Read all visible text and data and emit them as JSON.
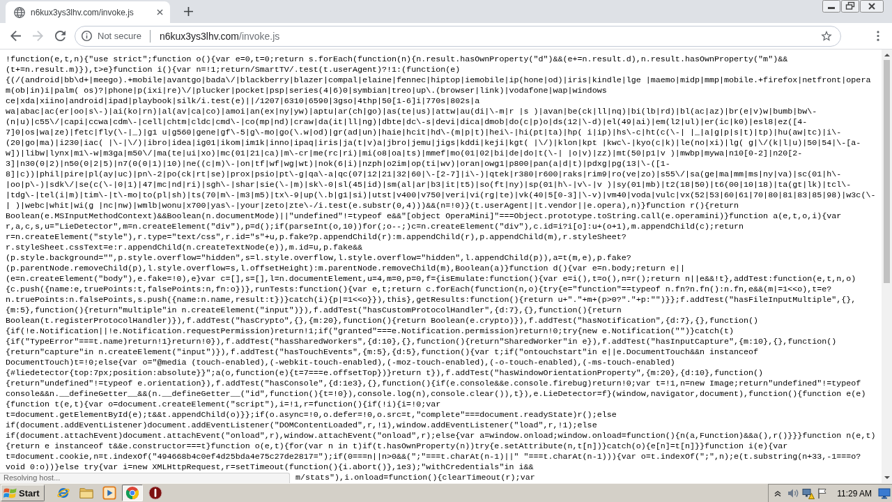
{
  "tabs": [
    {
      "title": "n6kux3ys3lhv.com/invoke.js",
      "selected": true
    }
  ],
  "toolbar": {
    "nav_buttons": [
      {
        "kind": "back",
        "disabled": false
      },
      {
        "kind": "forward",
        "disabled": true
      },
      {
        "kind": "reload",
        "disabled": false
      }
    ],
    "address": {
      "security_label": "Not secure",
      "host": "n6kux3ys3lhv.com",
      "path": "/invoke.js"
    }
  },
  "page": {
    "lines": [
      "!function(e,t,n){\"use strict\";function o(){var e=0,t=0;return s.forEach(function(n){n.result.hasOwnProperty(\"d\")&&(e+=n.result.d),n.result.hasOwnProperty(\"m\")&&",
      "(t+=n.result.m)}),t>e}function i(){var n=!1;return/SmartTV/.test(t.userAgent)?!1:(function(e)",
      "{(/(android|bb\\d+|meego).+mobile|avantgo|bada\\/|blackberry|blazer|compal|elaine|fennec|hiptop|iemobile|ip(hone|od)|iris|kindle|lge |maemo|midp|mmp|mobile.+firefox|netfront|opera",
      "m(ob|in)i|palm( os)?|phone|p(ixi|re)\\/|plucker|pocket|psp|series(4|6)0|symbian|treo|up\\.(browser|link)|vodafone|wap|windows",
      "ce|xda|xiino|android|ipad|playbook|silk/i.test(e)||/1207|6310|6590|3gso|4thp|50[1-6]i|770s|802s|a",
      "wa|abac|ac(er|oo|s\\-)|ai(ko|rn)|al(av|ca|co)|amoi|an(ex|ny|yw)|aptu|ar(ch|go)|as(te|us)|attw|au(di|\\-m|r |s )|avan|be(ck|ll|nq)|bi(lb|rd)|bl(ac|az)|br(e|v)w|bumb|bw\\-",
      "(n|u)|c55\\/|capi|ccwa|cdm\\-|cell|chtm|cldc|cmd\\-|co(mp|nd)|craw|da(it|ll|ng)|dbte|dc\\-s|devi|dica|dmob|do(c|p)o|ds(12|\\-d)|el(49|ai)|em(l2|ul)|er(ic|k0)|esl8|ez([4-",
      "7]0|os|wa|ze)|fetc|fly(\\-|_)|g1 u|g560|gene|gf\\-5|g\\-mo|go(\\.w|od)|gr(ad|un)|haie|hcit|hd\\-(m|p|t)|hei\\-|hi(pt|ta)|hp( i|ip)|hs\\-c|ht(c(\\-| |_|a|g|p|s|t)|tp)|hu(aw|tc)|i\\-",
      "(20|go|ma)|i230|iac( |\\-|\\/)|ibro|idea|ig01|ikom|im1k|inno|ipaq|iris|ja(t|v)a|jbro|jemu|jigs|kddi|keji|kgt( |\\/)|klon|kpt |kwc\\-|kyo(c|k)|le(no|xi)|lg( g|\\/(k|l|u)|50|54|\\-[a-",
      "w])|libw|lynx|m1\\-w|m3ga|m50\\/|ma(te|ui|xo)|mc(01|21|ca)|m\\-cr|me(rc|ri)|mi(o8|oa|ts)|mmef|mo(01|02|bi|de|do|t(\\-| |o|v)|zz)|mt(50|p1|v )|mwbp|mywa|n10[0-2]|n20[2-",
      "3]|n30(0|2)|n50(0|2|5)|n7(0(0|1)|10)|ne((c|m)\\-|on|tf|wf|wg|wt)|nok(6|i)|nzph|o2im|op(ti|wv)|oran|owg1|p800|pan(a|d|t)|pdxg|pg(13|\\-([1-",
      "8]|c))|phil|pire|pl(ay|uc)|pn\\-2|po(ck|rt|se)|prox|psio|pt\\-g|qa\\-a|qc(07|12|21|32|60|\\-[2-7]|i\\-)|qtek|r380|r600|raks|rim9|ro(ve|zo)|s55\\/|sa(ge|ma|mm|ms|ny|va)|sc(01|h\\-",
      "|oo|p\\-)|sdk\\/|se(c(\\-|0|1)|47|mc|nd|ri)|sgh\\-|shar|sie(\\-|m)|sk\\-0|sl(45|id)|sm(al|ar|b3|it|t5)|so(ft|ny)|sp(01|h\\-|v\\-|v )|sy(01|mb)|t2(18|50)|t6(00|10|18)|ta(gt|lk)|tcl\\-",
      "|tdg\\-|tel(i|m)|tim\\-|t\\-mo|to(pl|sh)|ts(70|m\\-|m3|m5)|tx\\-9|up(\\.b|g1|si)|utst|v400|v750|veri|vi(rg|te)|vk(40|5[0-3]|\\-v)|vm40|voda|vulc|vx(52|53|60|61|70|80|81|83|85|98)|w3c(\\-",
      "| )|webc|whit|wi(g |nc|nw)|wmlb|wonu|x700|yas\\-|your|zeto|zte\\-/i.test(e.substr(0,4)))&&(n=!0)}(t.userAgent||t.vendor||e.opera),n)}function r(){return",
      "Boolean(e.MSInputMethodContext)&&Boolean(n.documentMode)||\"undefined\"!=typeof e&&\"[object OperaMini]\"===Object.prototype.toString.call(e.operamini)}function a(e,t,o,i){var",
      "r,a,c,s,u=\"LieDetector\",m=n.createElement(\"div\"),p=d();if(parseInt(o,10))for(;o--;)c=n.createElement(\"div\"),c.id=i?i[o]:u+(o+1),m.appendChild(c);return",
      "r=n.createElement(\"style\"),r.type=\"text/css\",r.id=\"s\"+u,p.fake?p.appendChild(r):m.appendChild(r),p.appendChild(m),r.styleSheet?",
      "r.styleSheet.cssText=e:r.appendChild(n.createTextNode(e)),m.id=u,p.fake&&",
      "(p.style.background=\"\",p.style.overflow=\"hidden\",s=l.style.overflow,l.style.overflow=\"hidden\",l.appendChild(p)),a=t(m,e),p.fake?",
      "(p.parentNode.removeChild(p),l.style.overflow=s,l.offsetHeight):m.parentNode.removeChild(m),Boolean(a)}function d(){var e=n.body;return e||",
      "(e=n.createElement(\"body\"),e.fake=!0),e}var c=[],s=[],l=n.documentElement,u=4,m=0,p=0,f={isEmulate:function(){var e=i(),t=o(),n=r();return n||e&&!t},addTest:function(e,t,n,o)",
      "{c.push({name:e,truePoints:t,falsePoints:n,fn:o})},runTests:function(){var e,t;return c.forEach(function(n,o){try{e=\"function\"==typeof n.fn?n.fn():n.fn,e&&(m|=1<<o),t=e?",
      "n.truePoints:n.falsePoints,s.push({name:n.name,result:t})}catch(i){p|=1<<o}}),this},getResults:function(){return u+\".\"+m+(p>0?\".\"+p:\"\")}};f.addTest(\"hasFileInputMultiple\",{},",
      "{m:5},function(){return\"multiple\"in n.createElement(\"input\")}),f.addTest(\"hasCustomProtocolHandler\",{d:7},{},function(){return",
      "Boolean(t.registerProtocolHandler)}),f.addTest(\"hasCrypto\",{},{m:20},function(){return Boolean(e.crypto)}),f.addTest(\"hasNotification\",{d:7},{},function()",
      "{if(!e.Notification||!e.Notification.requestPermission)return!1;if(\"granted\"===e.Notification.permission)return!0;try{new e.Notification(\"\")}catch(t)",
      "{if(\"TypeError\"===t.name)return!1}return!0}),f.addTest(\"hasSharedWorkers\",{d:10},{},function(){return\"SharedWorker\"in e}),f.addTest(\"hasInputCapture\",{m:10},{},function()",
      "{return\"capture\"in n.createElement(\"input\")}),f.addTest(\"hasTouchEvents\",{m:5},{d:5},function(){var t;if(\"ontouchstart\"in e||e.DocumentTouch&&n instanceof",
      "DocumentTouch)t=!0;else{var o=\"@media (touch-enabled),(-webkit-touch-enabled),(-moz-touch-enabled),(-o-touch-enabled),(-ms-touch-enabled)",
      "{#liedetector{top:7px;position:absolute}}\";a(o,function(e){t=7===e.offsetTop})}return t}),f.addTest(\"hasWindowOrientationProperty\",{m:20},{d:10},function()",
      "{return\"undefined\"!=typeof e.orientation}),f.addTest(\"hasConsole\",{d:1e3},{},function(){if(e.console&&e.console.firebug)return!0;var t=!1,n=new Image;return\"undefined\"!=typeof",
      "console&&n.__defineGetter__&&(n.__defineGetter__(\"id\",function(){t=!0}),console.log(n),console.clear()),t}),e.LieDetector=f}(window,navigator,document),function(){function e(e)",
      "{function t(e,t){var o=document.createElement(\"script\"),i=!1,r=function(){if(!i){i=!0;var",
      "t=document.getElementById(e);t&&t.appendChild(o)}};if(o.async=!0,o.defer=!0,o.src=t,\"complete\"===document.readyState)r();else",
      "if(document.addEventListener)document.addEventListener(\"DOMContentLoaded\",r,!1),window.addEventListener(\"load\",r,!1);else",
      "if(document.attachEvent)document.attachEvent(\"onload\",r),window.attachEvent(\"onload\",r);else{var a=window.onload;window.onload=function(){n(a,Function)&&a(),r()}}}function n(e,t)",
      "{return e instanceof t&&e.constructor===t}function o(e,t){for(var n in t)if(t.hasOwnProperty(n))try{e.setAttribute(n,t[n])}catch(o){e[n]=t[n]}}function i(e){var",
      "t=document.cookie,n=t.indexOf(\"494668b4c0ef4d25bda4e75c27de2817=\");if(0===n||n>0&&(\";\"===t.charAt(n-1)||\" \"===t.charAt(n-1))){var o=t.indexOf(\";\",n);e(t.substring(n+33,-1===o?",
      "void 0:o))}else try{var i=new XMLHttpRequest,r=setTimeout(function(){i.abort()},1e3);\"withCredentials\"in i&&",
      "m/stats\"),i.onload=function(){clearTimeout(r);var"
    ]
  },
  "status_bubble": {
    "text": "Resolving host..."
  },
  "taskbar": {
    "start_label": "Start",
    "apps": [
      {
        "kind": "ie",
        "selected": false
      },
      {
        "kind": "explorer",
        "selected": false
      },
      {
        "kind": "media_player",
        "selected": false
      },
      {
        "kind": "chrome",
        "selected": true
      },
      {
        "kind": "stop",
        "selected": false
      }
    ],
    "clock": "11:29 AM"
  }
}
